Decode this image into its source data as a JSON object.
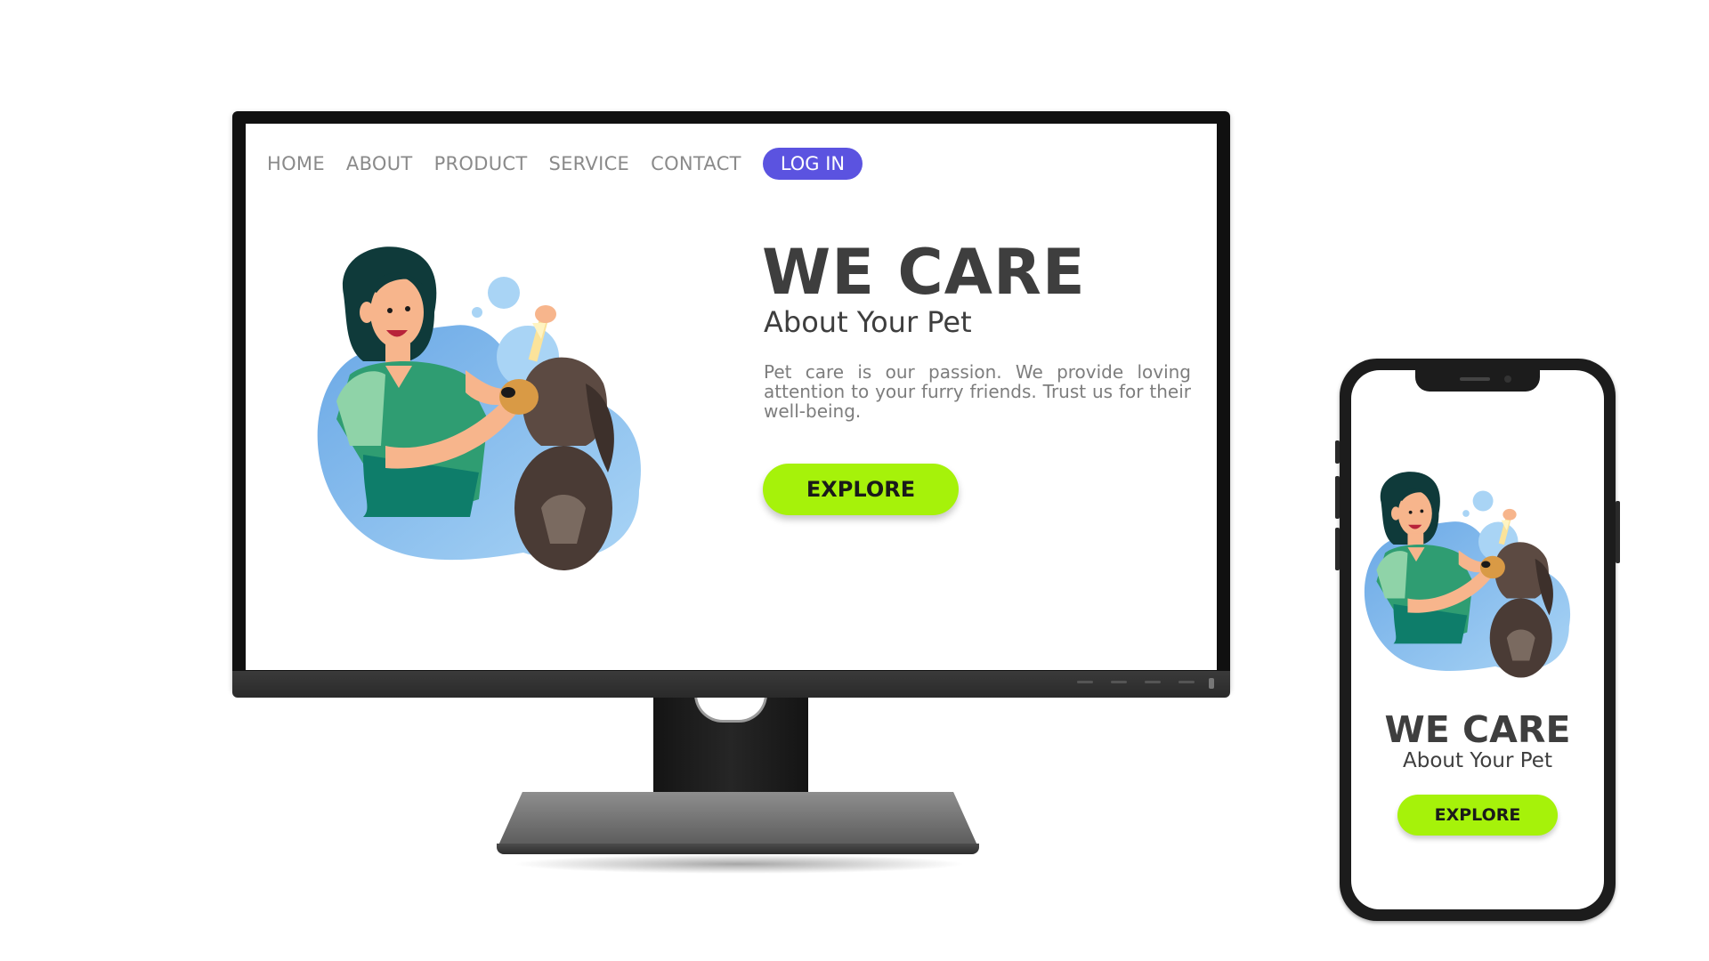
{
  "desktop": {
    "nav": {
      "items": [
        {
          "label": "HOME"
        },
        {
          "label": "ABOUT"
        },
        {
          "label": "PRODUCT"
        },
        {
          "label": "SERVICE"
        },
        {
          "label": "CONTACT"
        }
      ],
      "login_label": "LOG IN"
    },
    "hero": {
      "title": "WE CARE",
      "subtitle": "About Your Pet",
      "body": "Pet care is our passion. We provide loving attention to your furry friends. Trust us for their well-being.",
      "cta_label": "EXPLORE"
    }
  },
  "mobile": {
    "hero": {
      "title": "WE CARE",
      "subtitle": "About Your Pet",
      "cta_label": "EXPLORE"
    }
  },
  "colors": {
    "accent": "#5b53e0",
    "cta": "#a6f20a",
    "heading": "#3e3e3e",
    "nav_text": "#8a8a8a",
    "body_text": "#7d7d7d"
  },
  "icons": {
    "illustration": "woman-grooming-dog-illustration"
  }
}
